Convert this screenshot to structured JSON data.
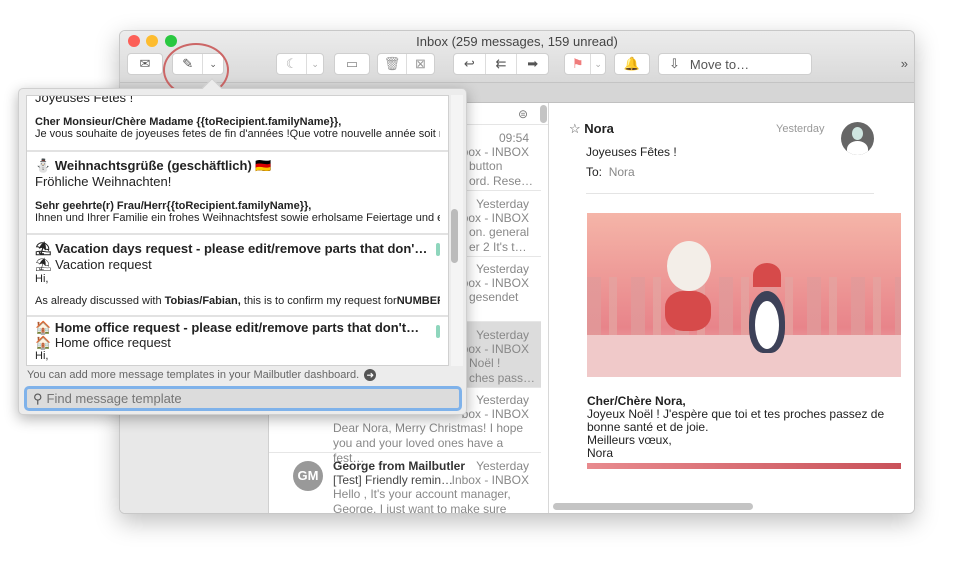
{
  "window": {
    "title": "Inbox (259 messages, 159 unread)"
  },
  "toolbar": {
    "buttons": [
      {
        "icon": "envelope-icon"
      },
      {
        "icon": "compose-icon"
      },
      {
        "icon": "chevron-down-icon"
      },
      {
        "icon": "snooze-moon-icon"
      },
      {
        "icon": "archive-icon"
      },
      {
        "icon": "trash-icon"
      },
      {
        "icon": "junk-icon"
      },
      {
        "icon": "reply-icon"
      },
      {
        "icon": "reply-all-icon"
      },
      {
        "icon": "forward-icon"
      },
      {
        "icon": "flag-icon"
      },
      {
        "icon": "bell-icon"
      }
    ],
    "move_to": "Move to…",
    "overflow": "»",
    "flag_color": "#f07c7c"
  },
  "message_list": {
    "rows": [
      {
        "time": "09:54",
        "box": "box - INBOX",
        "preview": "button\nord. Rese…"
      },
      {
        "time": "Yesterday",
        "box": "box - INBOX",
        "preview": "on. general\ner 2 It's t…"
      },
      {
        "time": "Yesterday",
        "box": "box - INBOX",
        "preview": "gesendet"
      },
      {
        "time": "Yesterday",
        "box": "box - INBOX",
        "preview": "Noël !\nches pass…",
        "selected": true
      },
      {
        "time": "Yesterday",
        "box": "box - INBOX",
        "preview": "Dear Nora, Merry Christmas! I hope you and your loved ones have a fest…"
      },
      {
        "time": "Yesterday",
        "from": "George from Mailbutler",
        "avatar": "GM",
        "subject": "[Test] Friendly remin…",
        "box": "Inbox - INBOX",
        "preview": "Hello , It's your account manager, George. I just want to make sure tha…"
      }
    ]
  },
  "preview": {
    "from": "Nora",
    "date": "Yesterday",
    "subject": "Joyeuses Fêtes !",
    "to_label": "To:",
    "to": "Nora",
    "greeting": "Cher/Chère Nora,",
    "body": "Joyeux Noël ! J'espère que toi et tes proches passez de bonne santé et de joie.",
    "closing": "Meilleurs vœux,",
    "signature": "Nora",
    "accent": "#d9686e"
  },
  "templates": {
    "items": [
      {
        "subject": "Joyeuses Fetes !",
        "salutation": "Cher Monsieur/Chère Madame {{toRecipient.familyName}},",
        "body": "Je vous souhaite de joyeuses fetes de fin d'années !Que votre nouvelle année soit re…"
      },
      {
        "emoji": "⛄",
        "title": "Weihnachtsgrüße (geschäftlich)",
        "flag": "🇩🇪",
        "subject": "Fröhliche Weihnachten!",
        "salutation": "Sehr geehrte(r) Frau/Herr{{toRecipient.familyName}},",
        "body": "Ihnen und Ihrer Familie ein frohes Weihnachtsfest sowie erholsame Feiertage und ein…"
      },
      {
        "emoji": "⛱",
        "title": "Vacation days request - please edit/remove parts that don'…",
        "subject": "Vacation request",
        "salutation": "Hi,",
        "body_pre": "As already discussed with ",
        "body_bold": "Tobias/Fabian,",
        "body_post": " this is to confirm my request for",
        "body_bold2": "NUMBER…"
      },
      {
        "emoji": "🏠",
        "title": "Home office request - please edit/remove parts that don't…",
        "subject": "Home office request",
        "salutation": "Hi,"
      }
    ],
    "footer": "You can add more message templates in your Mailbutler dashboard.",
    "search_placeholder": "Find message template"
  }
}
